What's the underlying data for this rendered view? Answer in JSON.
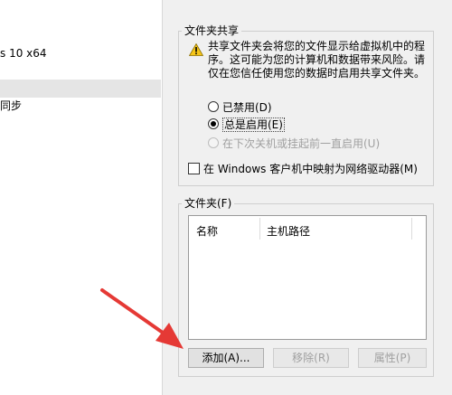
{
  "left_panel": {
    "items": [
      {
        "label": "s 10 x64"
      },
      {
        "label": "同步"
      }
    ]
  },
  "shared_folders": {
    "legend": "文件夹共享",
    "warning_icon": "warning-triangle-icon",
    "warning_text": "共享文件夹会将您的文件显示给虚拟机中的程序。这可能为您的计算机和数据带来风险。请仅在您信任使用您的数据时启用共享文件夹。",
    "options": [
      {
        "label": "已禁用(D)"
      },
      {
        "label": "总是启用(E)"
      },
      {
        "label": "在下次关机或挂起前一直启用(U)"
      }
    ],
    "selected_option": 1,
    "map_drive_label": "在 Windows 客户机中映射为网络驱动器(M)"
  },
  "folders": {
    "legend": "文件夹(F)",
    "columns": [
      "名称",
      "主机路径"
    ],
    "buttons": {
      "add": "添加(A)...",
      "remove": "移除(R)",
      "properties": "属性(P)"
    }
  },
  "colors": {
    "arrow": "#e53935",
    "warning": "#f5c518"
  }
}
